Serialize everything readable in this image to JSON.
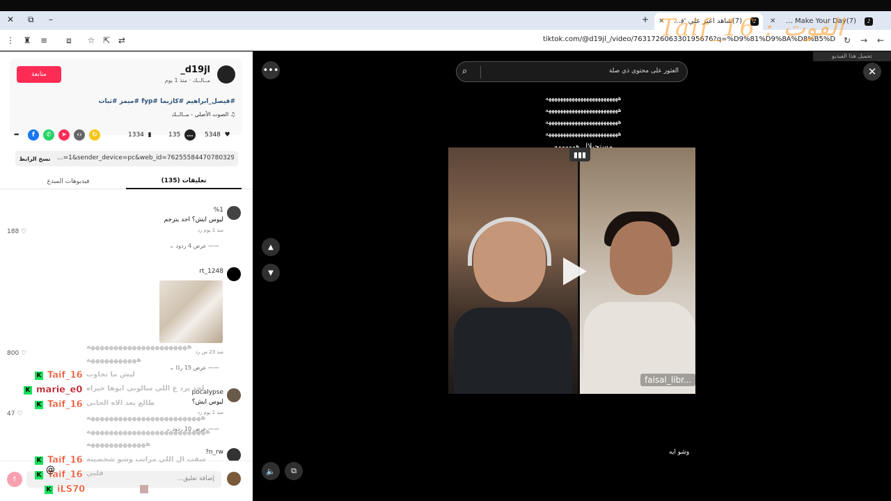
{
  "browser": {
    "tabs": [
      {
        "title": "(7)TikTok - Make Your Day",
        "favicon": "tiktok-icon"
      },
      {
        "title": "(7)شاهد اعتر علي 'فيصل ابراهيم ' على",
        "favicon": "tiktok-icon"
      }
    ],
    "url": "tiktok.com/@d19jl_/video/763172606330195676?q=%D9%81%D9%8A%D8%B5%D9%84%20%D8%A7%D8%A8%D8%B1%D8%A7%D9%87%D9%8A%D9%85&t=1770134249723"
  },
  "watermark": "Taif_16 : الفوت",
  "small_banner": "تحميل هذا الفيديو",
  "post": {
    "username": "_d19jl",
    "meta": "مــالــك · منذ 1 يوم",
    "follow_label": "متابعة",
    "hashtags": "#فيصل_ابراهيم #كازيما #fyp #ميمز #ثبات",
    "sound": "الصوت الأصلي - مــالــك",
    "likes": "5348",
    "comments": "135",
    "saves": "1334",
    "copy_label": "نسخ الرابط",
    "link": "...=1&sender_device=pc&web_id=7625558447078032904",
    "tab_comments": "(135) تعليقات",
    "tab_creator": "فيديوهات المبدع"
  },
  "comments": [
    {
      "name": "%1",
      "text": "ليوس ايش؟ احد يترجم",
      "sub": "منذ 1 يوم    رد",
      "likes": "188",
      "replies": "عرض 4 ردود"
    },
    {
      "name": "rt_1248",
      "text": "",
      "sub": "منذ 23 س    رد",
      "likes": "800",
      "replies": "عرض 15 ردًا"
    },
    {
      "name": "pocalypse",
      "text": "ليوس ايش؟",
      "sub": "منذ 1 يوم    رد",
      "likes": "47",
      "replies": "عرض 10 ردود"
    },
    {
      "name": "n_rw?",
      "text": "",
      "sub": "",
      "likes": "",
      "replies": ""
    }
  ],
  "comment_input_placeholder": "إضافة تعليق...",
  "chat": {
    "names": [
      "Taif_16",
      "marie_e0",
      "Taif_16",
      "Taif_16",
      "Taif_16",
      "iLS70"
    ],
    "messages": [
      "ههههههههههههههههههههههه",
      "هههههههههههه",
      "ليش ما تجاوب",
      "لحد يرد ع اللي سالوني ابوها حيزاه",
      "طالع بعد الاه الحاني",
      "هههههههههههههههههههههههههه",
      "ههههههههههههههههههههههههههه",
      "هههههههههههههه",
      "شفت ال اللي مراتب وشو شخصيته",
      "قلبي"
    ]
  },
  "video": {
    "search_text": "العثور على محتوى ذي صلة",
    "overlay_lines": [
      "هههههههههههههههههههههههههه",
      "هههههههههههههههههههههههههه",
      "هههههههههههههههههههههههههه",
      "هههههههههههههههههههههههههه",
      "مستحيلال ههههههه"
    ],
    "username_tag": "faisal_libr...",
    "caption": "وشو ايه"
  }
}
